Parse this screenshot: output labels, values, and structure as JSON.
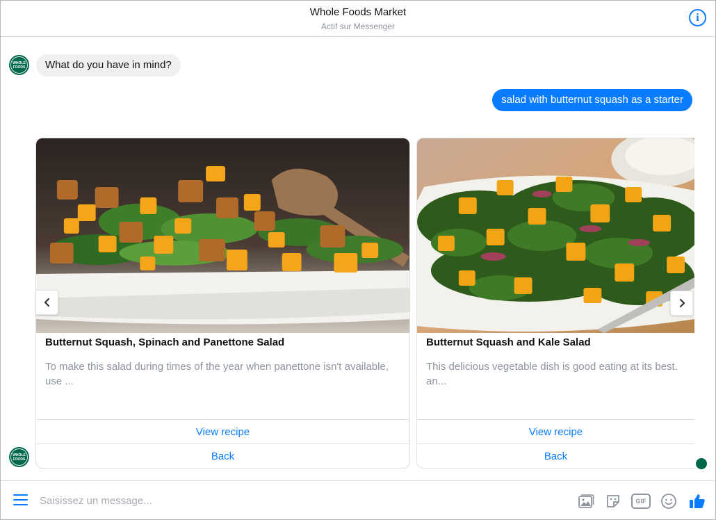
{
  "header": {
    "title": "Whole Foods Market",
    "subtitle": "Actif sur Messenger",
    "info_icon": "info-icon"
  },
  "bot": {
    "avatar_text": "WHOLE FOODS",
    "avatar_color": "#00674b"
  },
  "messages": [
    {
      "from": "bot",
      "text": "What do you have in mind?"
    },
    {
      "from": "user",
      "text": "salad with butternut squash as a starter"
    }
  ],
  "cards": [
    {
      "title": "Butternut Squash, Spinach and Panettone Salad",
      "description": "To make this salad during times of the year when panettone isn't available, use ...",
      "buttons": [
        "View recipe",
        "Back"
      ]
    },
    {
      "title": "Butternut Squash and Kale Salad",
      "description": "This delicious vegetable dish is good eating at its best. an...",
      "buttons": [
        "View recipe",
        "Back"
      ]
    }
  ],
  "carousel": {
    "prev_icon": "chevron-left-icon",
    "next_icon": "chevron-right-icon"
  },
  "composer": {
    "placeholder": "Saisissez un message...",
    "tools": [
      "image-icon",
      "sticker-icon",
      "gif-icon",
      "emoji-icon",
      "thumbs-up-icon"
    ],
    "gif_label": "GIF"
  },
  "colors": {
    "accent": "#0a7cff",
    "incoming_bubble": "#f1f0f0",
    "secondary_text": "#8d949e"
  }
}
